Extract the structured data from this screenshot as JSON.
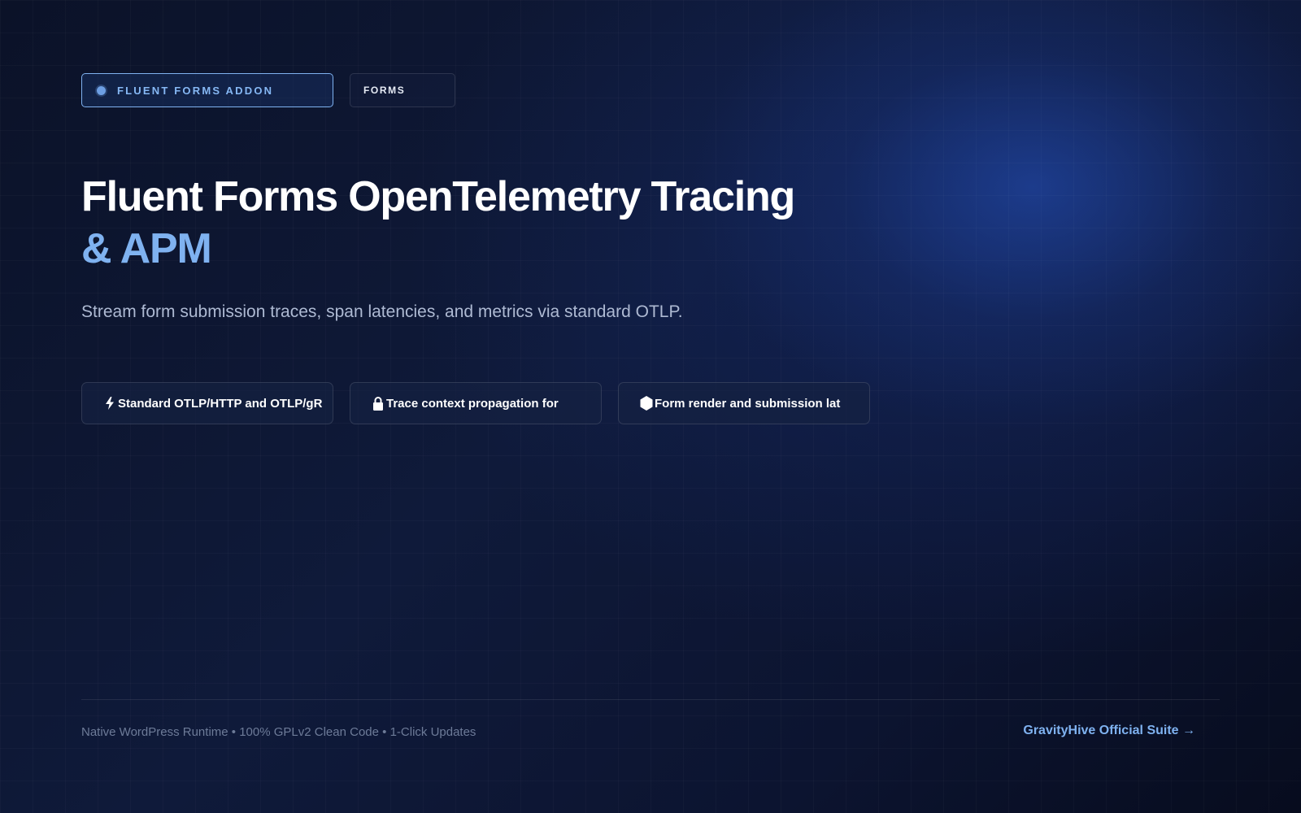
{
  "header": {
    "badge_primary": "FLUENT FORMS ADDON",
    "badge_secondary": "FORMS"
  },
  "hero": {
    "title_line1": "Fluent Forms OpenTelemetry Tracing",
    "title_line2": "& APM",
    "subtitle": "Stream form submission traces, span latencies, and metrics via standard OTLP."
  },
  "features": [
    {
      "icon": "lightning-icon",
      "label": "Standard OTLP/HTTP and OTLP/gR"
    },
    {
      "icon": "lock-icon",
      "label": "Trace context propagation for"
    },
    {
      "icon": "hexagon-icon",
      "label": "Form render and submission lat"
    }
  ],
  "footer": {
    "tagline": "Native WordPress Runtime • 100% GPLv2 Clean Code • 1-Click Updates",
    "link": "GravityHive Official Suite →"
  },
  "colors": {
    "accent": "#7fb2f0",
    "background": "#0f1a3a",
    "muted_text": "#6d7b98"
  }
}
